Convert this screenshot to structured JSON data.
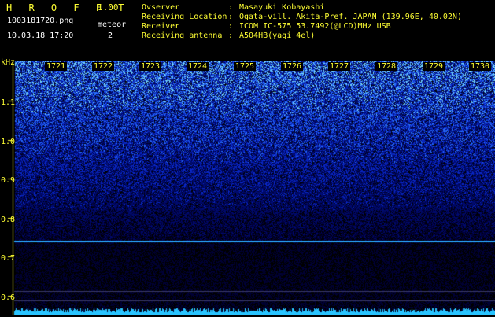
{
  "header": {
    "title": "H R O F F T",
    "version": "1.00",
    "filename": "1003181720.png",
    "datetime": "10.03.18 17:20",
    "meteor_label": "meteor",
    "meteor_count": "2"
  },
  "info": [
    {
      "key": "Ovserver",
      "sep": ":",
      "value": "Masayuki Kobayashi"
    },
    {
      "key": "Receiving Location",
      "sep": ":",
      "value": "Ogata-vill. Akita-Pref. JAPAN (139.96E, 40.02N)"
    },
    {
      "key": "Receiver",
      "sep": ":",
      "value": "ICOM IC-575 53.7492(@LCD)MHz USB"
    },
    {
      "key": "Receiving antenna",
      "sep": ":",
      "value": "A504HB(yagi 4el)"
    }
  ],
  "y_axis": {
    "unit": "kHz",
    "ticks": [
      "1.1",
      "1.0",
      "0.9",
      "0.8",
      "0.7",
      "0.6"
    ]
  },
  "minute_labels": [
    "1721",
    "1722",
    "1723",
    "1724",
    "1725",
    "1726",
    "1727",
    "1728",
    "1729",
    "1730"
  ],
  "colors": {
    "accent": "#ffff33",
    "background": "#000000",
    "signal": "#1e64ff"
  }
}
